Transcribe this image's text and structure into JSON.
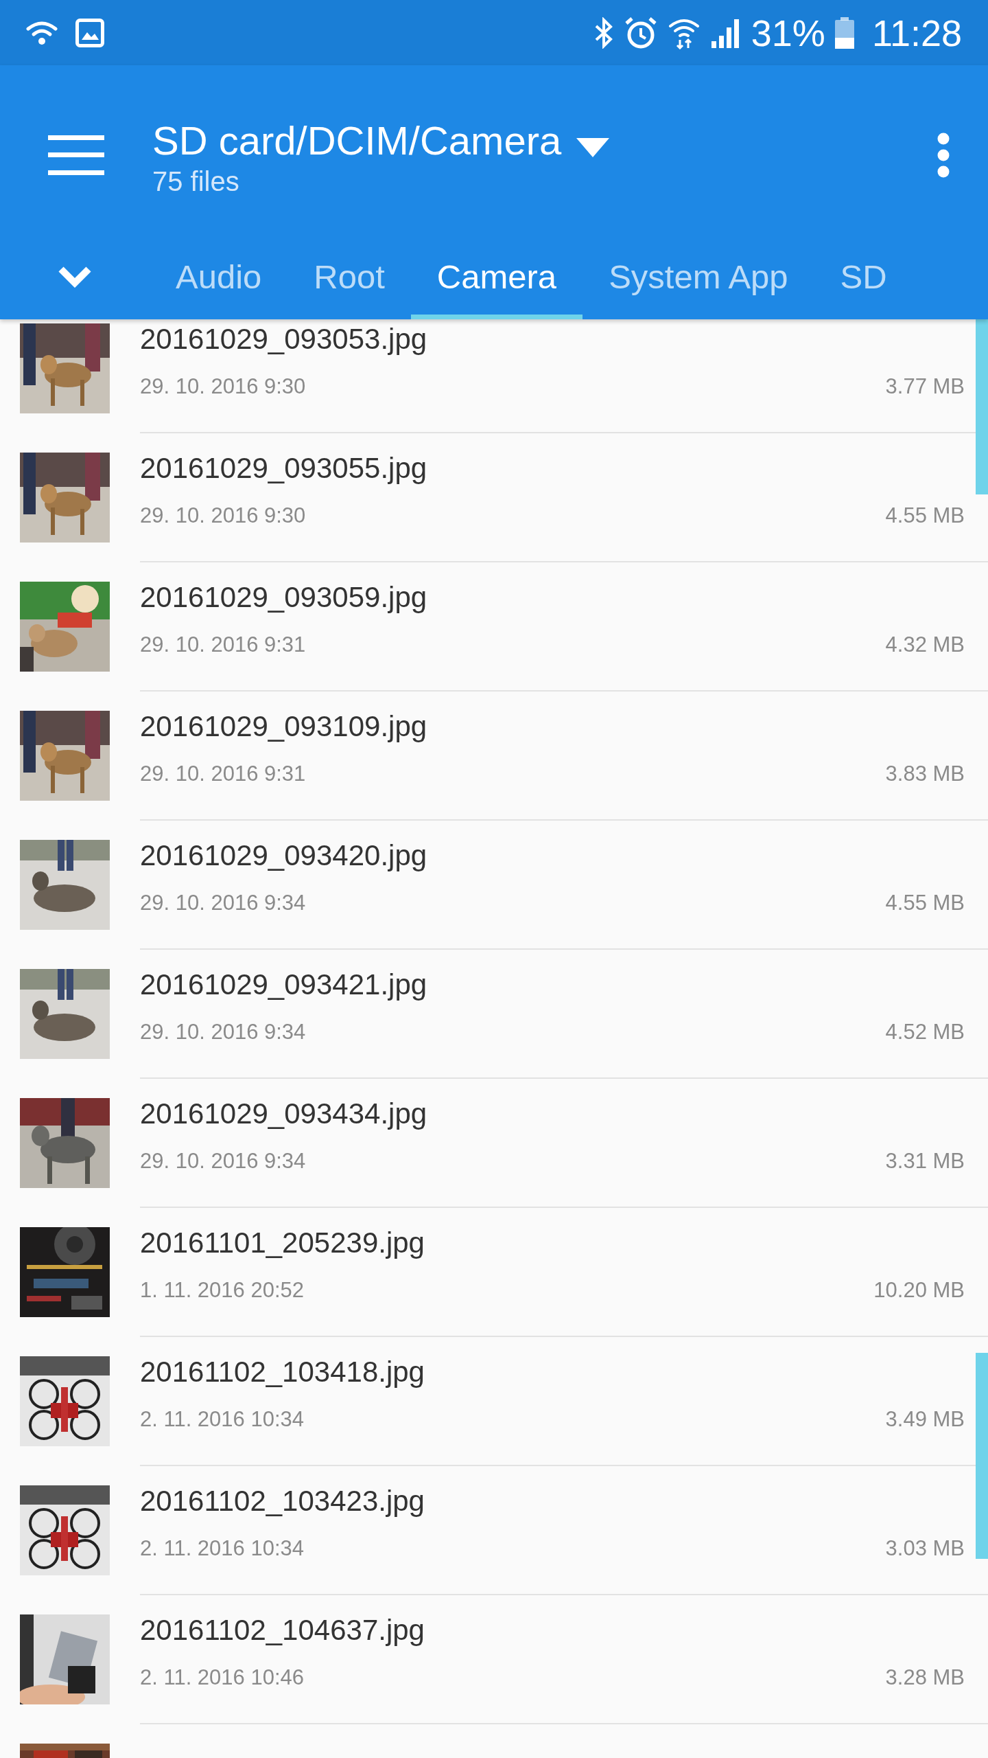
{
  "status_bar": {
    "battery_percent": "31%",
    "time": "11:28"
  },
  "app_bar": {
    "path": "SD card/DCIM/Camera",
    "subtitle": "75 files"
  },
  "tabs": [
    {
      "label": "Audio",
      "selected": false
    },
    {
      "label": "Root",
      "selected": false
    },
    {
      "label": "Camera",
      "selected": true
    },
    {
      "label": "System App",
      "selected": false
    },
    {
      "label": "SD",
      "selected": false
    }
  ],
  "files": [
    {
      "name": "20161029_093053.jpg",
      "date": "29. 10. 2016 9:30",
      "size": "3.77 MB"
    },
    {
      "name": "20161029_093055.jpg",
      "date": "29. 10. 2016 9:30",
      "size": "4.55 MB"
    },
    {
      "name": "20161029_093059.jpg",
      "date": "29. 10. 2016 9:31",
      "size": "4.32 MB"
    },
    {
      "name": "20161029_093109.jpg",
      "date": "29. 10. 2016 9:31",
      "size": "3.83 MB"
    },
    {
      "name": "20161029_093420.jpg",
      "date": "29. 10. 2016 9:34",
      "size": "4.55 MB"
    },
    {
      "name": "20161029_093421.jpg",
      "date": "29. 10. 2016 9:34",
      "size": "4.52 MB"
    },
    {
      "name": "20161029_093434.jpg",
      "date": "29. 10. 2016 9:34",
      "size": "3.31 MB"
    },
    {
      "name": "20161101_205239.jpg",
      "date": "1. 11. 2016 20:52",
      "size": "10.20 MB"
    },
    {
      "name": "20161102_103418.jpg",
      "date": "2. 11. 2016 10:34",
      "size": "3.49 MB"
    },
    {
      "name": "20161102_103423.jpg",
      "date": "2. 11. 2016 10:34",
      "size": "3.03 MB"
    },
    {
      "name": "20161102_104637.jpg",
      "date": "2. 11. 2016 10:46",
      "size": "3.28 MB"
    }
  ]
}
